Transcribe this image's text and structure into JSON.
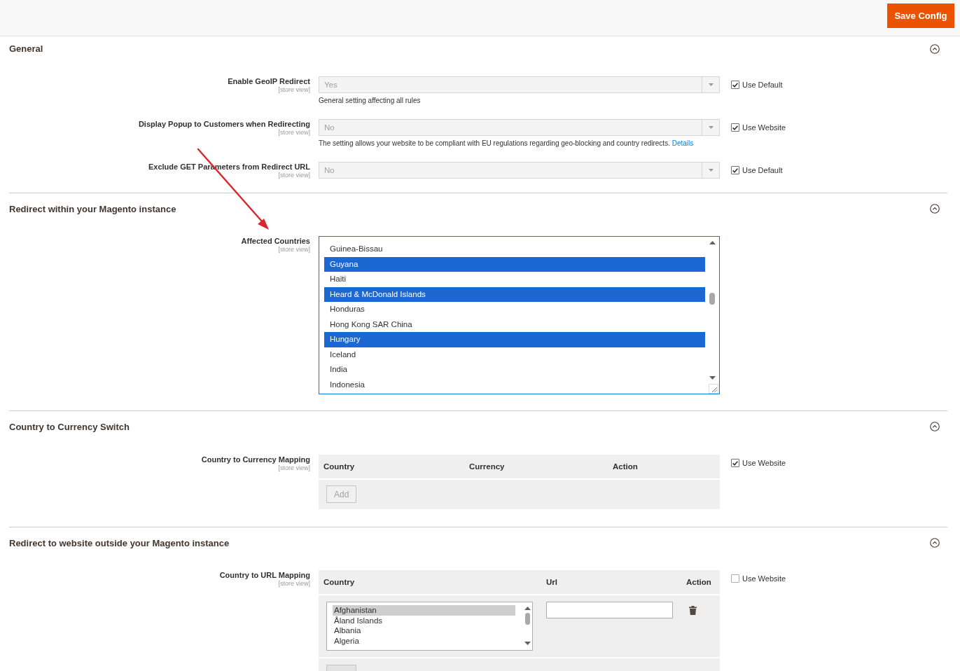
{
  "header": {
    "save_button": "Save Config"
  },
  "sections": [
    {
      "title": "General",
      "expanded": true,
      "fields": [
        {
          "kind": "select",
          "label": "Enable GeoIP Redirect",
          "scope": "[store view]",
          "value": "Yes",
          "disabled": true,
          "note": "General setting affecting all rules",
          "inherit": {
            "label": "Use Default",
            "checked": true
          }
        },
        {
          "kind": "select",
          "label": "Display Popup to Customers when Redirecting",
          "scope": "[store view]",
          "value": "No",
          "disabled": true,
          "note": "The setting allows your website to be compliant with EU regulations regarding geo-blocking and country redirects.",
          "note_link": "Details",
          "inherit": {
            "label": "Use Website",
            "checked": true
          }
        },
        {
          "kind": "select",
          "label": "Exclude GET Parameters from Redirect URL",
          "scope": "[store view]",
          "value": "No",
          "disabled": true,
          "inherit": {
            "label": "Use Default",
            "checked": true
          }
        }
      ]
    },
    {
      "title": "Redirect within your Magento instance",
      "expanded": true,
      "fields": [
        {
          "kind": "multiselect",
          "label": "Affected Countries",
          "scope": "[store view]",
          "options": [
            {
              "label": "Guinea-Bissau",
              "selected": false
            },
            {
              "label": "Guyana",
              "selected": true
            },
            {
              "label": "Haiti",
              "selected": false
            },
            {
              "label": "Heard & McDonald Islands",
              "selected": true
            },
            {
              "label": "Honduras",
              "selected": false
            },
            {
              "label": "Hong Kong SAR China",
              "selected": false
            },
            {
              "label": "Hungary",
              "selected": true
            },
            {
              "label": "Iceland",
              "selected": false
            },
            {
              "label": "India",
              "selected": false
            },
            {
              "label": "Indonesia",
              "selected": false
            }
          ]
        }
      ]
    },
    {
      "title": "Country to Currency Switch",
      "expanded": true,
      "fields": [
        {
          "kind": "grid",
          "label": "Country to Currency Mapping",
          "scope": "[store view]",
          "columns": [
            "Country",
            "Currency",
            "Action"
          ],
          "add_button": {
            "label": "Add",
            "disabled": true
          },
          "inherit": {
            "label": "Use Website",
            "checked": true
          }
        }
      ]
    },
    {
      "title": "Redirect to website outside your Magento instance",
      "expanded": true,
      "fields": [
        {
          "kind": "grid",
          "label": "Country to URL Mapping",
          "scope": "[store view]",
          "columns": [
            "Country",
            "Url",
            "Action"
          ],
          "rows": [
            {
              "country_options": [
                {
                  "label": "Afghanistan",
                  "selected": true
                },
                {
                  "label": "Åland Islands",
                  "selected": false
                },
                {
                  "label": "Albania",
                  "selected": false
                },
                {
                  "label": "Algeria",
                  "selected": false
                }
              ]
            }
          ],
          "inherit": {
            "label": "Use Website",
            "checked": false
          }
        }
      ]
    }
  ]
}
